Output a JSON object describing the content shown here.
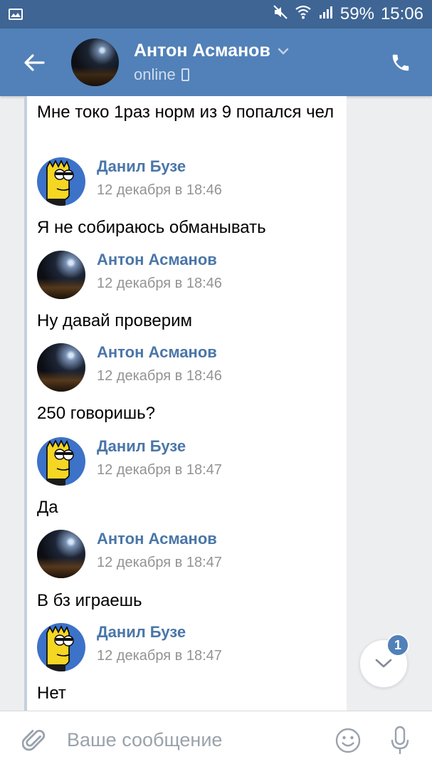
{
  "status_bar": {
    "battery": "59%",
    "time": "15:06",
    "icons": [
      "gallery-icon",
      "mute-icon",
      "wifi-icon",
      "signal-icon"
    ]
  },
  "header": {
    "name": "Антон Асманов",
    "status": "online",
    "icons": [
      "back-arrow-icon",
      "chevron-down-icon",
      "mobile-icon",
      "phone-icon"
    ]
  },
  "messages": [
    {
      "type": "text",
      "text": "Мне токо 1раз норм из 9 попался чел"
    },
    {
      "type": "author",
      "author": "Данил Бузе",
      "avatar": "danil",
      "date": "12 декабря в 18:46"
    },
    {
      "type": "text",
      "text": "Я не собираюсь обманывать"
    },
    {
      "type": "author",
      "author": "Антон Асманов",
      "avatar": "anton",
      "date": "12 декабря в 18:46"
    },
    {
      "type": "text",
      "text": "Ну давай проверим"
    },
    {
      "type": "author",
      "author": "Антон Асманов",
      "avatar": "anton",
      "date": "12 декабря в 18:46"
    },
    {
      "type": "text",
      "text": "250 говоришь?"
    },
    {
      "type": "author",
      "author": "Данил Бузе",
      "avatar": "danil",
      "date": "12 декабря в 18:47"
    },
    {
      "type": "text",
      "text": "Да"
    },
    {
      "type": "author",
      "author": "Антон Асманов",
      "avatar": "anton",
      "date": "12 декабря в 18:47"
    },
    {
      "type": "text",
      "text": "В бз играешь"
    },
    {
      "type": "author",
      "author": "Данил Бузе",
      "avatar": "danil",
      "date": "12 декабря в 18:47"
    },
    {
      "type": "text",
      "text": "Нет"
    }
  ],
  "scroll_down": {
    "badge": "1"
  },
  "composer": {
    "placeholder": "Ваше сообщение",
    "value": ""
  },
  "colors": {
    "status_bar": "#3e6594",
    "header": "#5181b8",
    "author_link": "#4a76a8",
    "date": "#939393"
  }
}
